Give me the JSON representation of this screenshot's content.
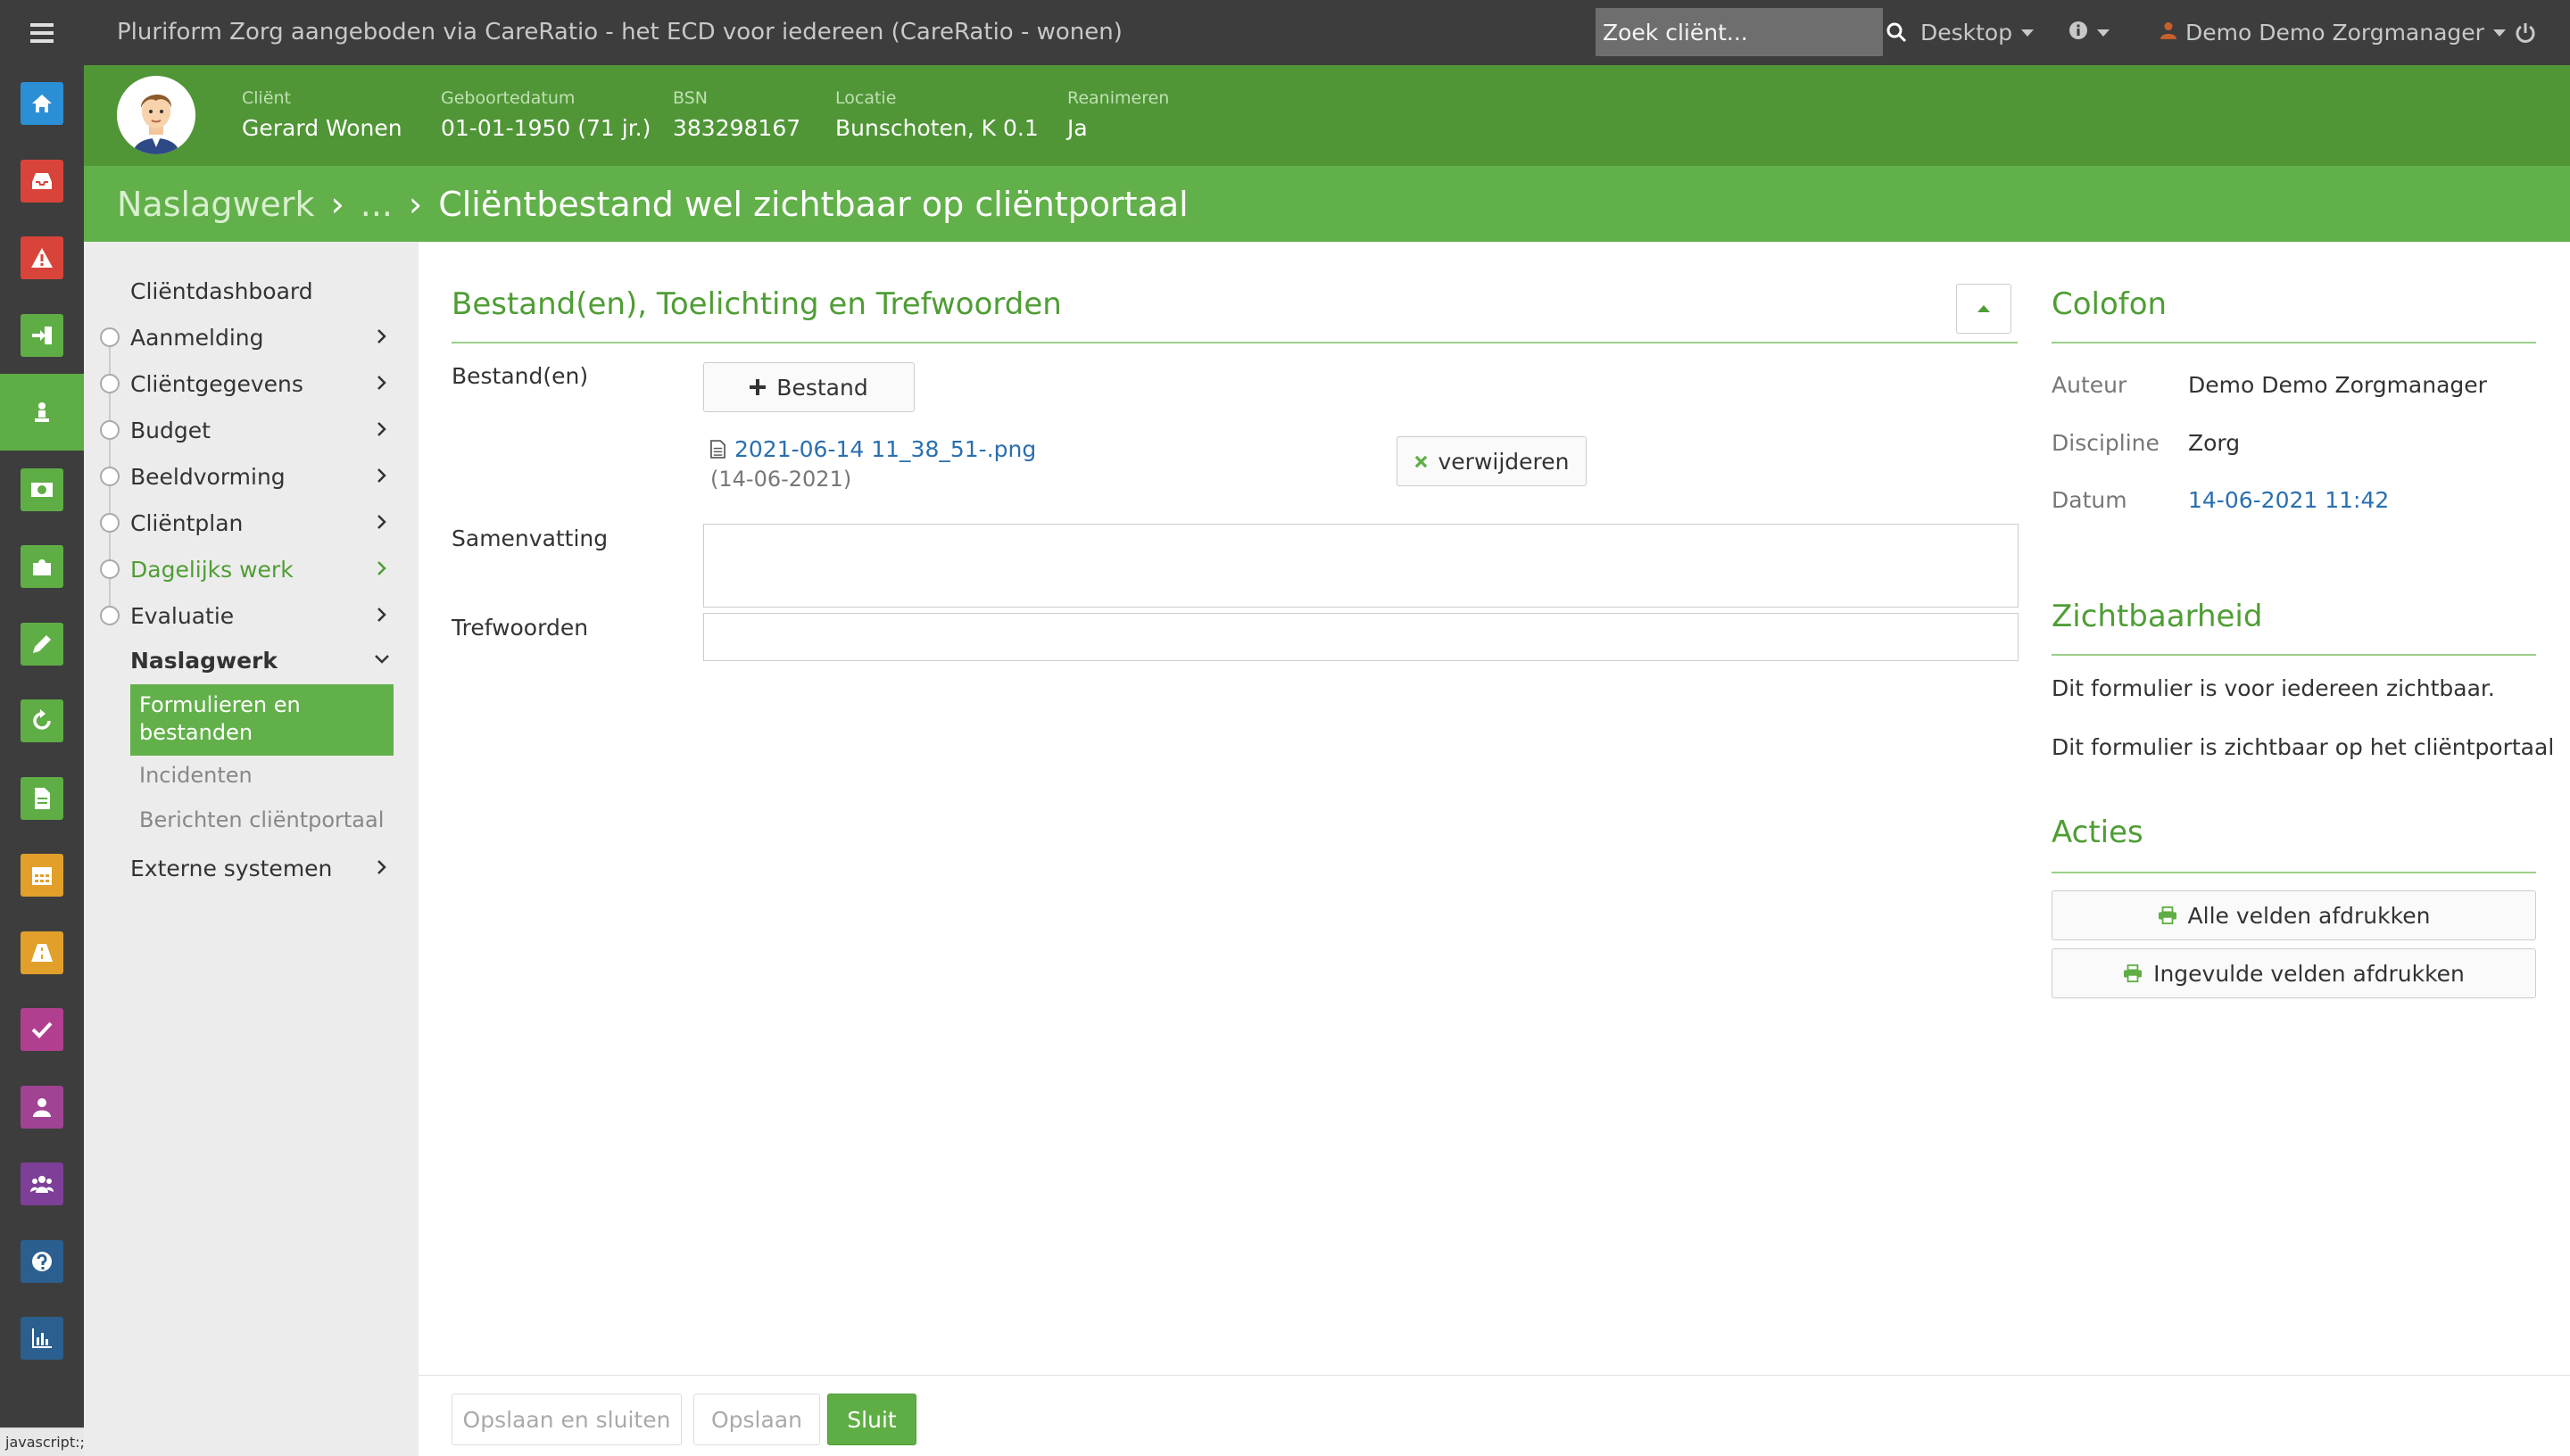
{
  "topbar": {
    "title": "Pluriform Zorg aangeboden via CareRatio - het ECD voor iedereen  (CareRatio - wonen)",
    "search_placeholder": "Zoek cliënt...",
    "desktop_label": "Desktop",
    "user_label": "Demo Demo Zorgmanager"
  },
  "rail": {
    "icons": [
      {
        "name": "home-icon",
        "color": "#2b8fd6"
      },
      {
        "name": "inbox-icon",
        "color": "#d9443a"
      },
      {
        "name": "warning-icon",
        "color": "#d9443a"
      },
      {
        "name": "login-icon",
        "color": "#5fae45"
      },
      {
        "name": "client-icon",
        "color": "#5fae45"
      },
      {
        "name": "money-icon",
        "color": "#5fae45"
      },
      {
        "name": "puzzle-icon",
        "color": "#5fae45"
      },
      {
        "name": "pencil-icon",
        "color": "#5fae45"
      },
      {
        "name": "refresh-icon",
        "color": "#5fae45"
      },
      {
        "name": "document-icon",
        "color": "#5fae45"
      },
      {
        "name": "calendar-icon",
        "color": "#e2a02b"
      },
      {
        "name": "road-icon",
        "color": "#e2a02b"
      },
      {
        "name": "check-icon",
        "color": "#b0408f"
      },
      {
        "name": "user-icon",
        "color": "#a04393"
      },
      {
        "name": "group-icon",
        "color": "#7d3f98"
      },
      {
        "name": "help-icon",
        "color": "#2a5f8f"
      },
      {
        "name": "chart-icon",
        "color": "#2a5f8f"
      }
    ],
    "status_text": "javascript:;"
  },
  "client": {
    "client_label": "Cliënt",
    "client_value": "Gerard Wonen",
    "dob_label": "Geboortedatum",
    "dob_value": "01-01-1950 (71 jr.)",
    "bsn_label": "BSN",
    "bsn_value": "383298167",
    "location_label": "Locatie",
    "location_value": "Bunschoten, K 0.1",
    "resuscitate_label": "Reanimeren",
    "resuscitate_value": "Ja"
  },
  "breadcrumb": {
    "root": "Naslagwerk",
    "ellipsis": "...",
    "current": "Cliëntbestand wel zichtbaar op cliëntportaal"
  },
  "nav": {
    "dashboard": "Cliëntdashboard",
    "items": [
      "Aanmelding",
      "Cliëntgegevens",
      "Budget",
      "Beeldvorming",
      "Cliëntplan",
      "Dagelijks werk",
      "Evaluatie"
    ],
    "naslagwerk": "Naslagwerk",
    "active": "Formulieren en bestanden",
    "sub_incidents": "Incidenten",
    "sub_messages": "Berichten cliëntportaal",
    "external": "Externe systemen"
  },
  "form": {
    "section_title": "Bestand(en), Toelichting en Trefwoorden",
    "files_label": "Bestand(en)",
    "add_file_button": "Bestand",
    "file_name": "2021-06-14 11_38_51-.png",
    "file_date": "(14-06-2021)",
    "remove_button": "verwijderen",
    "summary_label": "Samenvatting",
    "keywords_label": "Trefwoorden"
  },
  "colofon": {
    "title": "Colofon",
    "author_label": "Auteur",
    "author_value": "Demo Demo Zorgmanager",
    "discipline_label": "Discipline",
    "discipline_value": "Zorg",
    "date_label": "Datum",
    "date_value": "14-06-2021 11:42"
  },
  "visibility": {
    "title": "Zichtbaarheid",
    "line1": "Dit formulier is voor iedereen zichtbaar.",
    "line2": "Dit formulier is zichtbaar op het cliëntportaal"
  },
  "actions": {
    "title": "Acties",
    "print_all": "Alle velden afdrukken",
    "print_filled": "Ingevulde velden afdrukken"
  },
  "footer": {
    "save_close": "Opslaan en sluiten",
    "save": "Opslaan",
    "close": "Sluit"
  }
}
